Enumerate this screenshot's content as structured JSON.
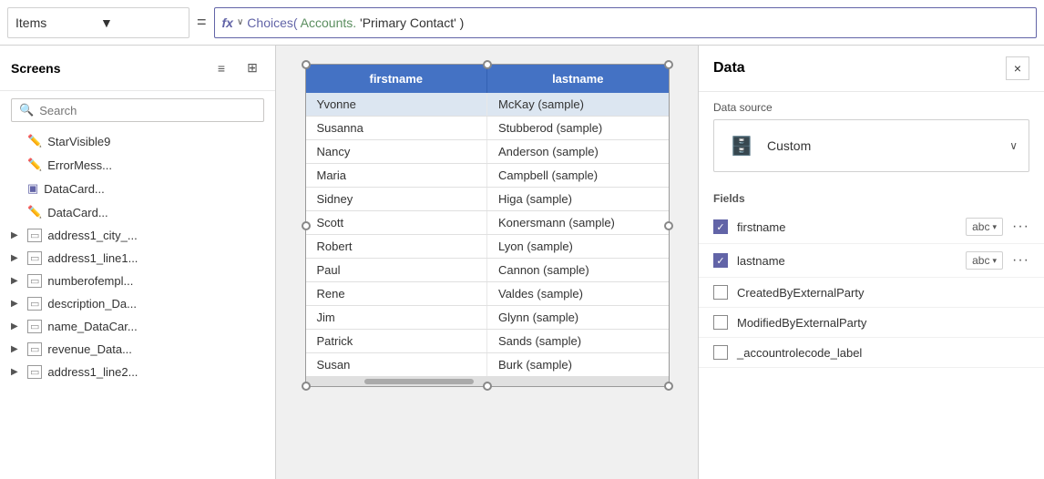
{
  "formula_bar": {
    "item_name": "Items",
    "equals": "=",
    "fx_label": "fx",
    "formula_choices": "Choices(",
    "formula_accounts": "Accounts.",
    "formula_rest": "'Primary Contact' )"
  },
  "left_panel": {
    "title": "Screens",
    "search_placeholder": "Search",
    "tree_items": [
      {
        "icon": "form",
        "label": "StarVisible9",
        "expandable": false
      },
      {
        "icon": "form",
        "label": "ErrorMess...",
        "expandable": false
      },
      {
        "icon": "card",
        "label": "DataCard...",
        "expandable": false
      },
      {
        "icon": "form",
        "label": "DataCard...",
        "expandable": false
      },
      {
        "icon": "group",
        "label": "address1_city_...",
        "expandable": true
      },
      {
        "icon": "group",
        "label": "address1_line1...",
        "expandable": true
      },
      {
        "icon": "group",
        "label": "numberofempl...",
        "expandable": true
      },
      {
        "icon": "group",
        "label": "description_Da...",
        "expandable": true
      },
      {
        "icon": "group",
        "label": "name_DataCar...",
        "expandable": true
      },
      {
        "icon": "group",
        "label": "revenue_Data...",
        "expandable": true
      },
      {
        "icon": "group",
        "label": "address1_line2...",
        "expandable": true
      }
    ]
  },
  "gallery": {
    "columns": [
      "firstname",
      "lastname"
    ],
    "rows": [
      {
        "firstname": "Yvonne",
        "lastname": "McKay (sample)",
        "selected": true
      },
      {
        "firstname": "Susanna",
        "lastname": "Stubberod (sample)",
        "selected": false
      },
      {
        "firstname": "Nancy",
        "lastname": "Anderson (sample)",
        "selected": false
      },
      {
        "firstname": "Maria",
        "lastname": "Campbell (sample)",
        "selected": false
      },
      {
        "firstname": "Sidney",
        "lastname": "Higa (sample)",
        "selected": false
      },
      {
        "firstname": "Scott",
        "lastname": "Konersmann (sample)",
        "selected": false
      },
      {
        "firstname": "Robert",
        "lastname": "Lyon (sample)",
        "selected": false
      },
      {
        "firstname": "Paul",
        "lastname": "Cannon (sample)",
        "selected": false
      },
      {
        "firstname": "Rene",
        "lastname": "Valdes (sample)",
        "selected": false
      },
      {
        "firstname": "Jim",
        "lastname": "Glynn (sample)",
        "selected": false
      },
      {
        "firstname": "Patrick",
        "lastname": "Sands (sample)",
        "selected": false
      },
      {
        "firstname": "Susan",
        "lastname": "Burk (sample)",
        "selected": false
      }
    ]
  },
  "right_panel": {
    "title": "Data",
    "close_label": "×",
    "datasource_label": "Data source",
    "datasource_name": "Custom",
    "fields_label": "Fields",
    "fields": [
      {
        "name": "firstname",
        "type": "abc",
        "checked": true,
        "has_more": true
      },
      {
        "name": "lastname",
        "type": "abc",
        "checked": true,
        "has_more": true
      },
      {
        "name": "CreatedByExternalParty",
        "type": "",
        "checked": false,
        "has_more": false
      },
      {
        "name": "ModifiedByExternalParty",
        "type": "",
        "checked": false,
        "has_more": false
      },
      {
        "name": "_accountrolecode_label",
        "type": "",
        "checked": false,
        "has_more": false
      }
    ]
  }
}
